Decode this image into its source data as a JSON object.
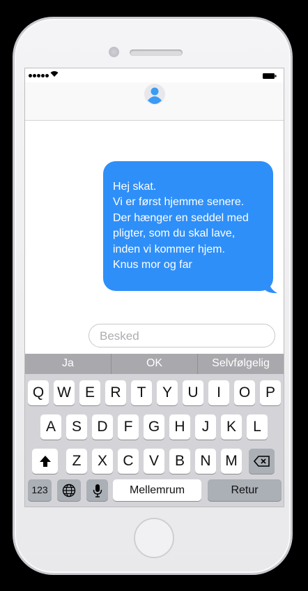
{
  "header": {
    "contact_avatar_icon": "person-icon"
  },
  "conversation": {
    "messages": [
      {
        "direction": "outgoing",
        "color": "#2f8ff8",
        "lines": [
          "Hej skat.",
          "Vi er først hjemme senere.",
          "Der hænger en seddel med",
          "pligter, som du skal lave,",
          "inden vi kommer hjem.",
          "Knus mor og far"
        ]
      }
    ]
  },
  "composer": {
    "placeholder": "Besked",
    "value": ""
  },
  "predictive": [
    "Ja",
    "OK",
    "Selvfølgelig"
  ],
  "keyboard": {
    "row1": [
      "Q",
      "W",
      "E",
      "R",
      "T",
      "Y",
      "U",
      "I",
      "O",
      "P"
    ],
    "row2": [
      "A",
      "S",
      "D",
      "F",
      "G",
      "H",
      "J",
      "K",
      "L"
    ],
    "row3": [
      "Z",
      "X",
      "C",
      "V",
      "B",
      "N",
      "M"
    ],
    "numbers_label": "123",
    "space_label": "Mellemrum",
    "return_label": "Retur",
    "icons": {
      "shift": "shift-arrow-icon",
      "delete": "backspace-icon",
      "globe": "globe-icon",
      "mic": "microphone-icon"
    }
  }
}
